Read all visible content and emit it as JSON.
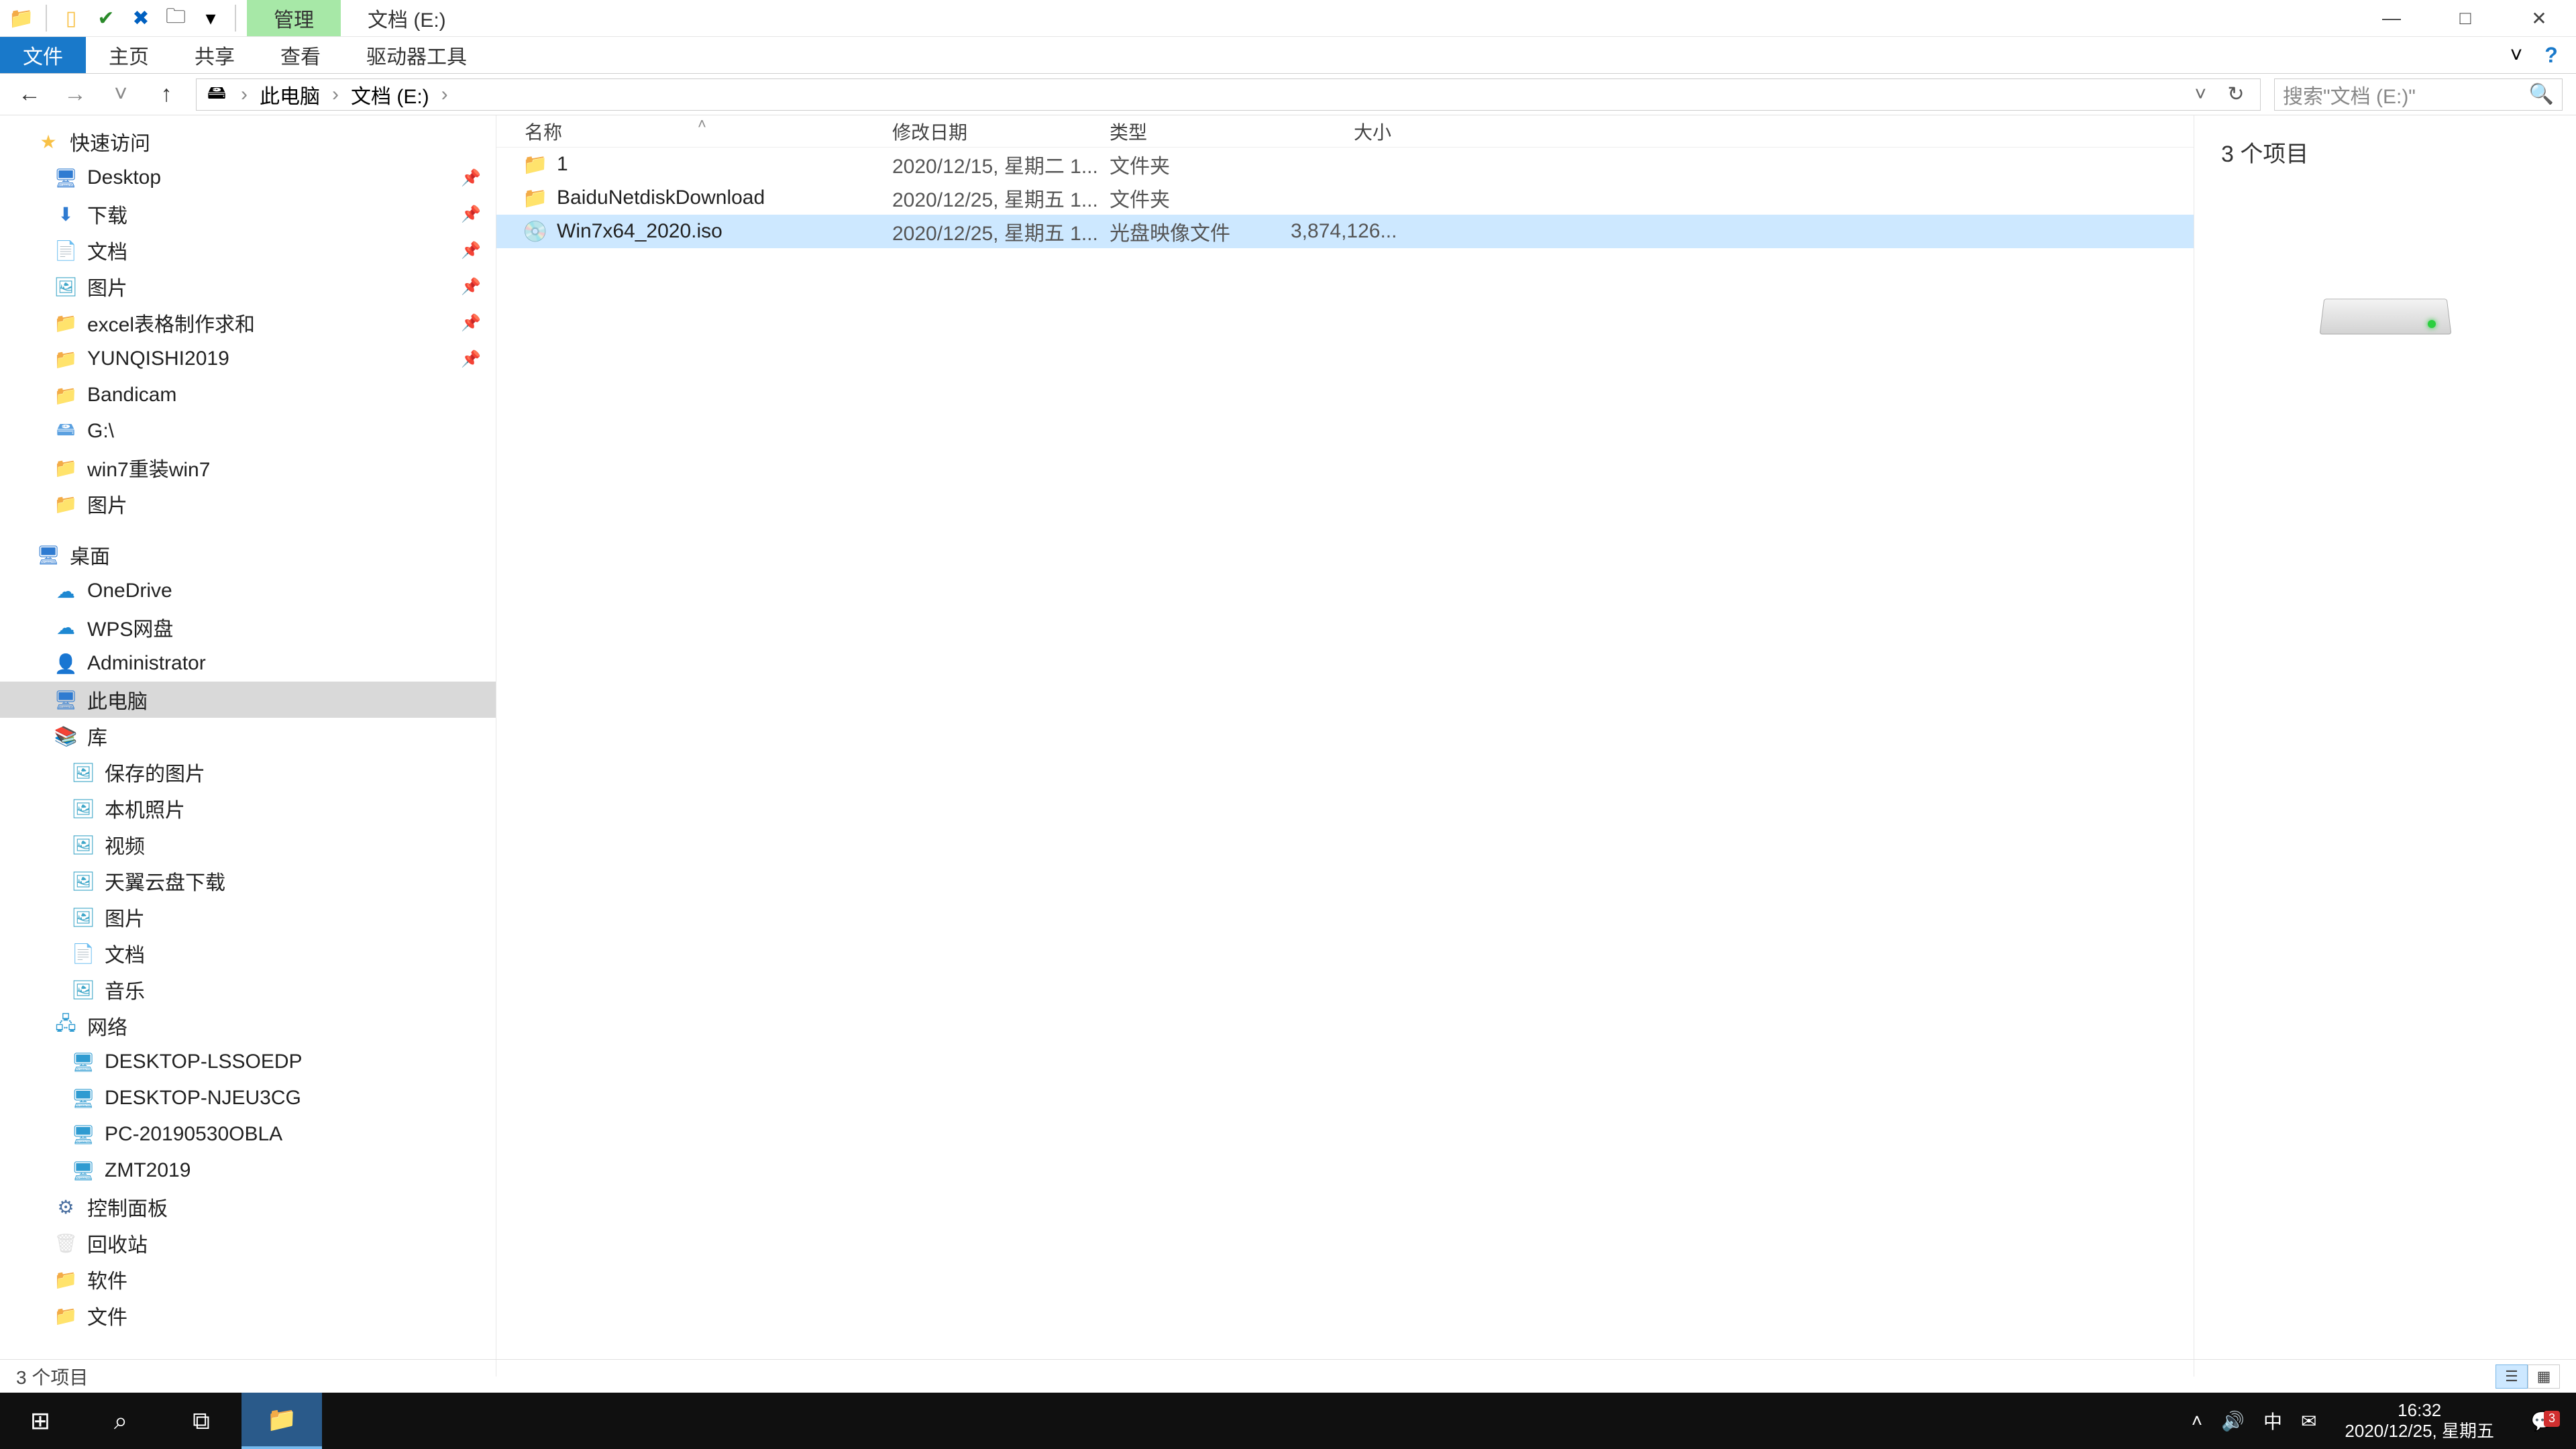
{
  "titlebar": {
    "contextual_tab": "管理",
    "location_tab": "文档 (E:)"
  },
  "ribbon": {
    "tabs": [
      "文件",
      "主页",
      "共享",
      "查看",
      "驱动器工具"
    ],
    "active_index": 0
  },
  "nav": {
    "breadcrumb": [
      "此电脑",
      "文档 (E:)"
    ],
    "search_placeholder": "搜索\"文档 (E:)\""
  },
  "columns": {
    "name": "名称",
    "date": "修改日期",
    "type": "类型",
    "size": "大小"
  },
  "files": [
    {
      "name": "1",
      "date": "2020/12/15, 星期二 1...",
      "type": "文件夹",
      "size": "",
      "icon": "folder",
      "selected": false
    },
    {
      "name": "BaiduNetdiskDownload",
      "date": "2020/12/25, 星期五 1...",
      "type": "文件夹",
      "size": "",
      "icon": "folder",
      "selected": false
    },
    {
      "name": "Win7x64_2020.iso",
      "date": "2020/12/25, 星期五 1...",
      "type": "光盘映像文件",
      "size": "3,874,126...",
      "icon": "disc",
      "selected": true
    }
  ],
  "tree": {
    "quick_access": "快速访问",
    "qa_items": [
      {
        "label": "Desktop",
        "icon": "monitor",
        "pinned": true
      },
      {
        "label": "下载",
        "icon": "down",
        "pinned": true
      },
      {
        "label": "文档",
        "icon": "doc",
        "pinned": true
      },
      {
        "label": "图片",
        "icon": "pic",
        "pinned": true
      },
      {
        "label": "excel表格制作求和",
        "icon": "folder",
        "pinned": true
      },
      {
        "label": "YUNQISHI2019",
        "icon": "folder",
        "pinned": true
      },
      {
        "label": "Bandicam",
        "icon": "folder",
        "pinned": false
      },
      {
        "label": "G:\\",
        "icon": "drive-g",
        "pinned": false
      },
      {
        "label": "win7重装win7",
        "icon": "folder",
        "pinned": false
      },
      {
        "label": "图片",
        "icon": "folder",
        "pinned": false
      }
    ],
    "desktop": "桌面",
    "desktop_items": [
      {
        "label": "OneDrive",
        "icon": "onedrive"
      },
      {
        "label": "WPS网盘",
        "icon": "wps"
      },
      {
        "label": "Administrator",
        "icon": "user"
      },
      {
        "label": "此电脑",
        "icon": "monitor",
        "selected": true
      },
      {
        "label": "库",
        "icon": "lib"
      }
    ],
    "lib_items": [
      {
        "label": "保存的图片",
        "icon": "pic"
      },
      {
        "label": "本机照片",
        "icon": "pic"
      },
      {
        "label": "视频",
        "icon": "pic"
      },
      {
        "label": "天翼云盘下载",
        "icon": "pic"
      },
      {
        "label": "图片",
        "icon": "pic"
      },
      {
        "label": "文档",
        "icon": "doc"
      },
      {
        "label": "音乐",
        "icon": "pic"
      }
    ],
    "network": "网络",
    "net_items": [
      {
        "label": "DESKTOP-LSSOEDP",
        "icon": "netpc"
      },
      {
        "label": "DESKTOP-NJEU3CG",
        "icon": "netpc"
      },
      {
        "label": "PC-20190530OBLA",
        "icon": "netpc"
      },
      {
        "label": "ZMT2019",
        "icon": "netpc"
      }
    ],
    "control_panel": "控制面板",
    "recycle": "回收站",
    "software": "软件",
    "wenjian": "文件"
  },
  "preview": {
    "count_label": "3 个项目"
  },
  "status": {
    "text": "3 个项目"
  },
  "taskbar": {
    "time": "16:32",
    "date": "2020/12/25, 星期五",
    "ime": "中",
    "notif_count": "3"
  }
}
